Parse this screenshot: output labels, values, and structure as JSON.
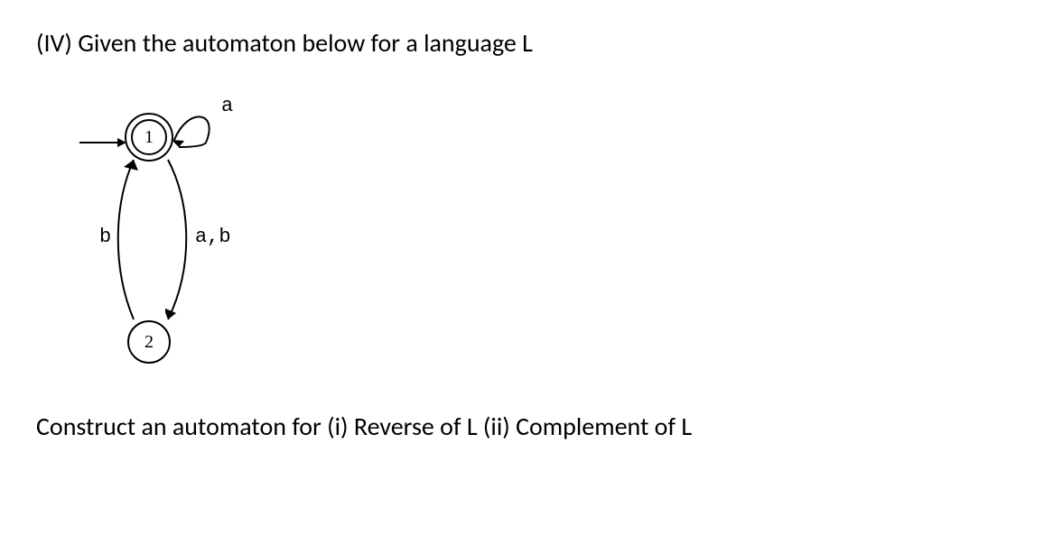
{
  "problem": {
    "intro": "(IV) Given the automaton below for a language L",
    "instruction": "Construct an automaton for (i) Reverse of L (ii) Complement of L"
  },
  "automaton": {
    "states": {
      "s1": {
        "label": "1",
        "type": "initial-accepting"
      },
      "s2": {
        "label": "2",
        "type": "normal"
      }
    },
    "transitions": [
      {
        "from": "1",
        "to": "1",
        "label": "a",
        "kind": "self-loop"
      },
      {
        "from": "1",
        "to": "2",
        "label": "a,b",
        "kind": "edge-down"
      },
      {
        "from": "2",
        "to": "1",
        "label": "b",
        "kind": "edge-up"
      }
    ]
  }
}
